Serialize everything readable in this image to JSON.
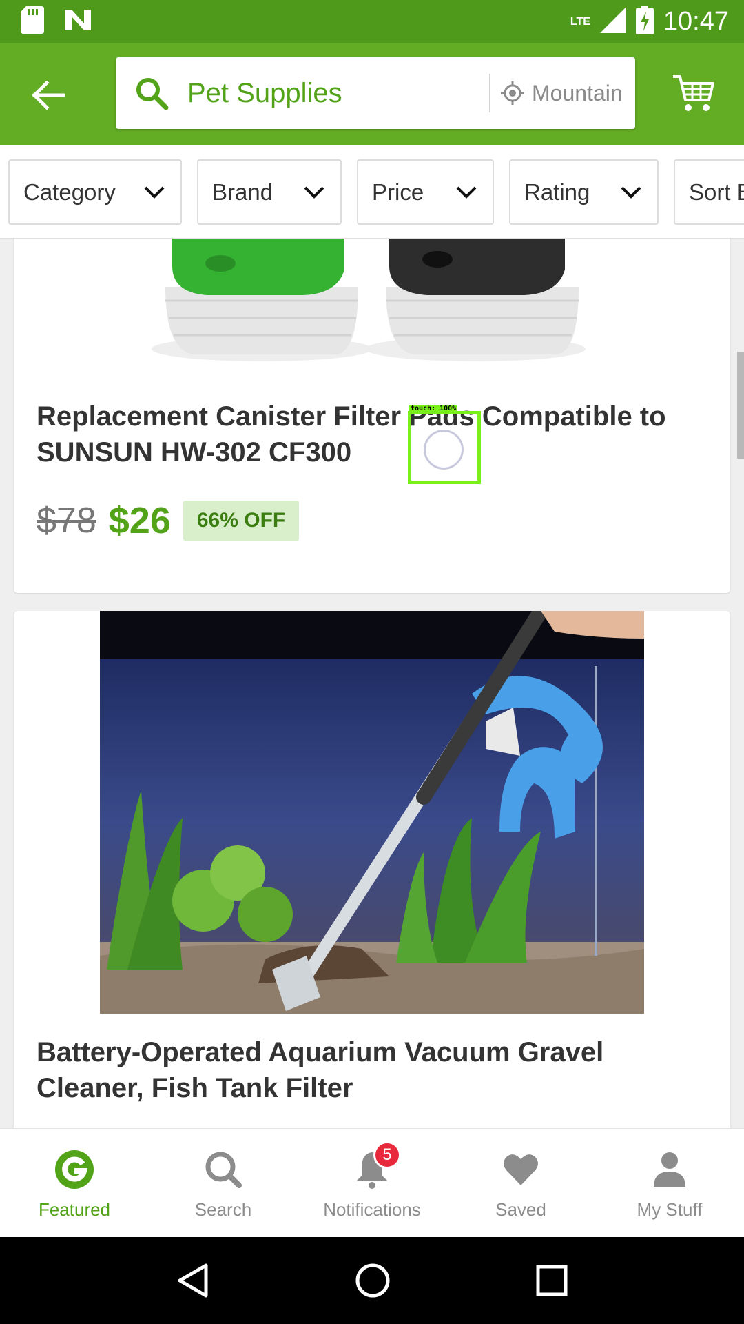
{
  "status_bar": {
    "time": "10:47",
    "network": "LTE"
  },
  "search": {
    "query": "Pet Supplies",
    "location": "Mountain"
  },
  "filters": [
    "Category",
    "Brand",
    "Price",
    "Rating",
    "Sort By"
  ],
  "products": [
    {
      "title": "Replacement Canister Filter Pads Compatible to SUNSUN HW-302 CF300",
      "old_price": "$78",
      "price": "$26",
      "discount": "66% OFF"
    },
    {
      "title": "Battery-Operated Aquarium Vacuum Gravel Cleaner, Fish Tank Filter"
    }
  ],
  "touch_indicator": {
    "label": "touch: 100%"
  },
  "bottom_nav": [
    {
      "label": "Featured",
      "icon": "g-logo-icon",
      "active": true
    },
    {
      "label": "Search",
      "icon": "search-icon"
    },
    {
      "label": "Notifications",
      "icon": "bell-icon",
      "badge": "5"
    },
    {
      "label": "Saved",
      "icon": "heart-icon"
    },
    {
      "label": "My Stuff",
      "icon": "person-icon"
    }
  ],
  "colors": {
    "brand": "#53a318",
    "status_bar": "#4f9a1b",
    "app_bar": "#62ad23",
    "badge": "#e8293b"
  }
}
